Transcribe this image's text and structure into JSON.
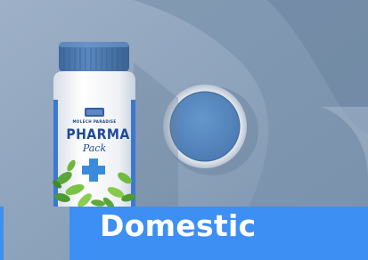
{
  "product_card": {
    "category_label": "Domestic",
    "label_brand": "MOLECH PARADISE",
    "label_title": "PHARMA",
    "label_subtitle": "Pack",
    "logo_text": "MOLECH"
  },
  "colors": {
    "background": "#8a9fb8",
    "shadow_shape": "#6f87a3",
    "bottle_cap": "#4b77a9",
    "bottle_body": "#f4f6f9",
    "cap_top": "#5c8dc5",
    "label_stripe": "#3b78d0",
    "cross": "#3b8bdc",
    "banner": "#3d8ff3",
    "banner_text": "#ffffff"
  }
}
